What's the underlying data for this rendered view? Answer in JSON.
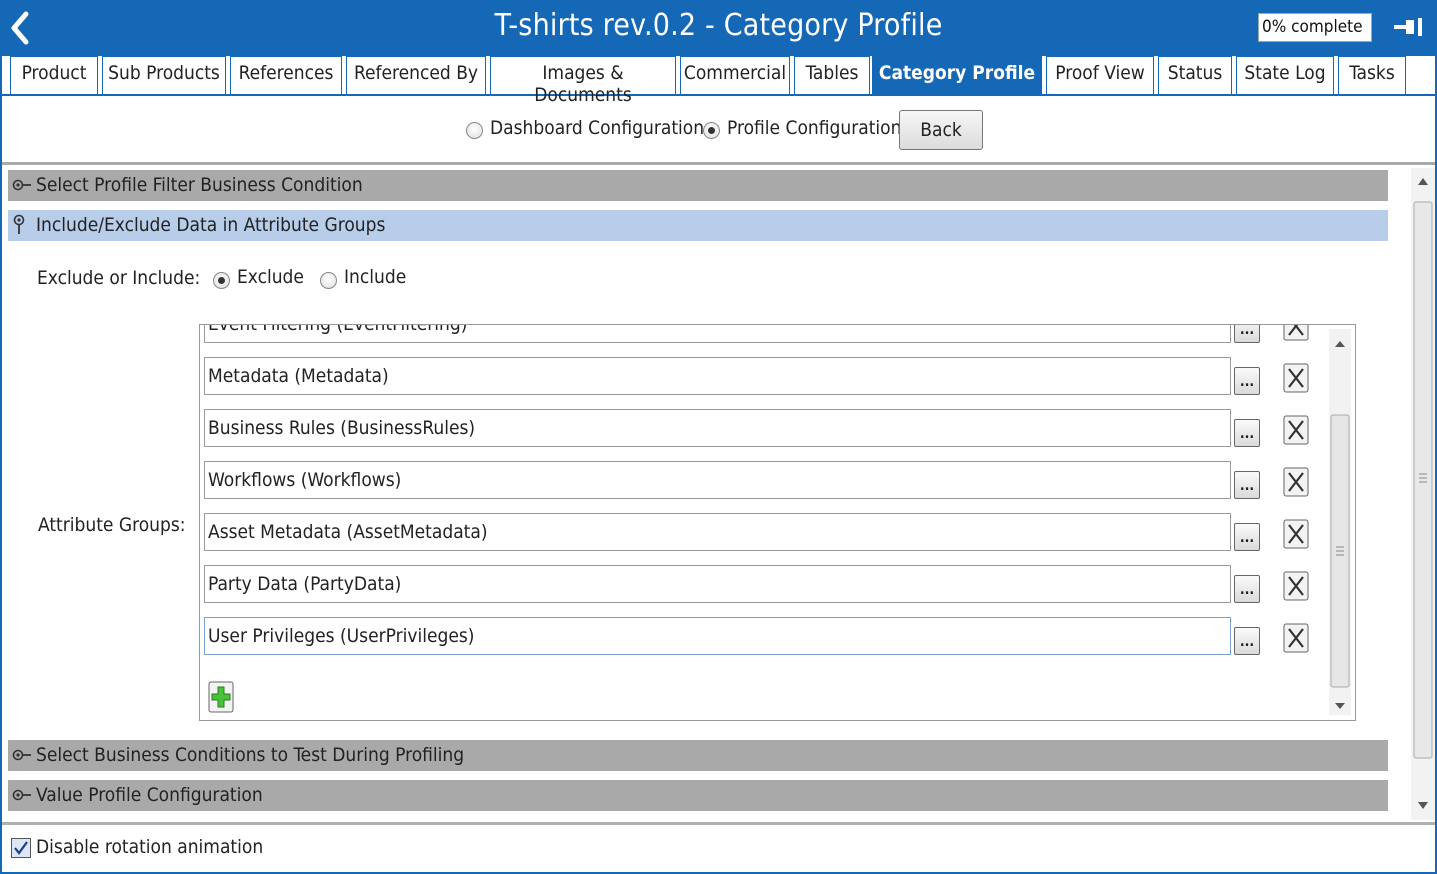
{
  "window": {
    "title": "T-shirts rev.0.2 - Category Profile",
    "progress": "0% complete",
    "accent_color": "#1468b5"
  },
  "tabs": [
    {
      "label": "Product"
    },
    {
      "label": "Sub Products"
    },
    {
      "label": "References"
    },
    {
      "label": "Referenced By"
    },
    {
      "label": "Images & Documents"
    },
    {
      "label": "Commercial"
    },
    {
      "label": "Tables"
    },
    {
      "label": "Category Profile",
      "active": true
    },
    {
      "label": "Proof View"
    },
    {
      "label": "Status"
    },
    {
      "label": "State Log"
    },
    {
      "label": "Tasks"
    }
  ],
  "config": {
    "dashboard_label": "Dashboard Configuration",
    "profile_label": "Profile Configuration",
    "selected": "Profile Configuration",
    "back_label": "Back"
  },
  "sections": {
    "filter_condition": "Select Profile Filter Business Condition",
    "include_exclude": "Include/Exclude Data in Attribute Groups",
    "business_conditions": "Select Business Conditions to Test During Profiling",
    "value_profile": "Value Profile Configuration"
  },
  "include_exclude": {
    "label": "Exclude or Include:",
    "exclude_label": "Exclude",
    "include_label": "Include",
    "selected": "Exclude"
  },
  "attribute_groups": {
    "label": "Attribute Groups:",
    "partial_top_item": "Event Filtering (EventFiltering)",
    "items": [
      "Metadata (Metadata)",
      "Business Rules (BusinessRules)",
      "Workflows (Workflows)",
      "Asset Metadata (AssetMetadata)",
      "Party Data (PartyData)",
      "User Privileges (UserPrivileges)"
    ],
    "browse_label": "..."
  },
  "footer": {
    "disable_rotation_label": "Disable rotation animation",
    "disable_rotation_checked": true
  }
}
